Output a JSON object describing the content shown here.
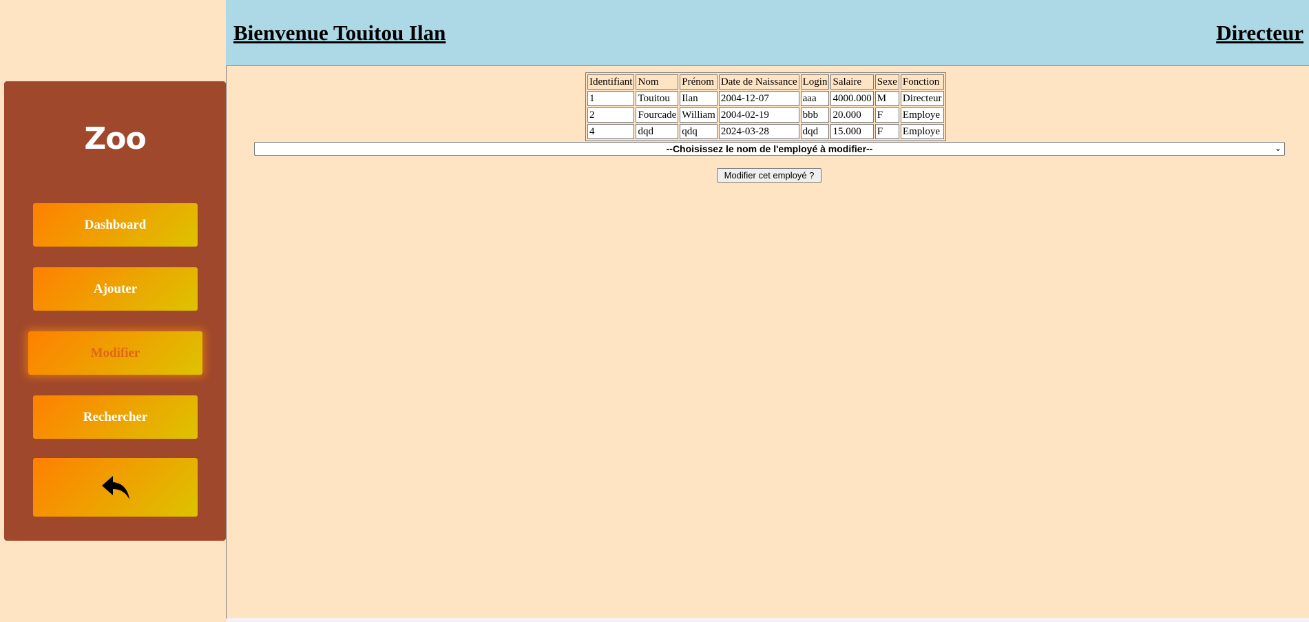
{
  "header": {
    "welcome": "Bienvenue Touitou Ilan",
    "role": "Directeur"
  },
  "sidebar": {
    "logo": "Zoo",
    "items": [
      {
        "label": "Dashboard"
      },
      {
        "label": "Ajouter"
      },
      {
        "label": "Modifier",
        "active": true
      },
      {
        "label": "Rechercher"
      }
    ],
    "back_icon": "undo-arrow-icon",
    "accent_gradient": [
      "#ff8000",
      "#ddc300"
    ],
    "panel_color": "#a0482c"
  },
  "table": {
    "headers": [
      "Identifiant",
      "Nom",
      "Prénom",
      "Date de Naissance",
      "Login",
      "Salaire",
      "Sexe",
      "Fonction"
    ],
    "rows": [
      [
        "1",
        "Touitou",
        "Ilan",
        "2004-12-07",
        "aaa",
        "4000.000",
        "M",
        "Directeur"
      ],
      [
        "2",
        "Fourcade",
        "William",
        "2004-02-19",
        "bbb",
        "20.000",
        "F",
        "Employe"
      ],
      [
        "4",
        "dqd",
        "qdq",
        "2024-03-28",
        "dqd",
        "15.000",
        "F",
        "Employe"
      ]
    ]
  },
  "form": {
    "select_placeholder": "--Choisissez le nom de l'employé à modifier--",
    "submit_label": "Modifier cet employé ?"
  },
  "colors": {
    "page_bg": "#ffe4c4",
    "header_bg": "#add8e6"
  }
}
